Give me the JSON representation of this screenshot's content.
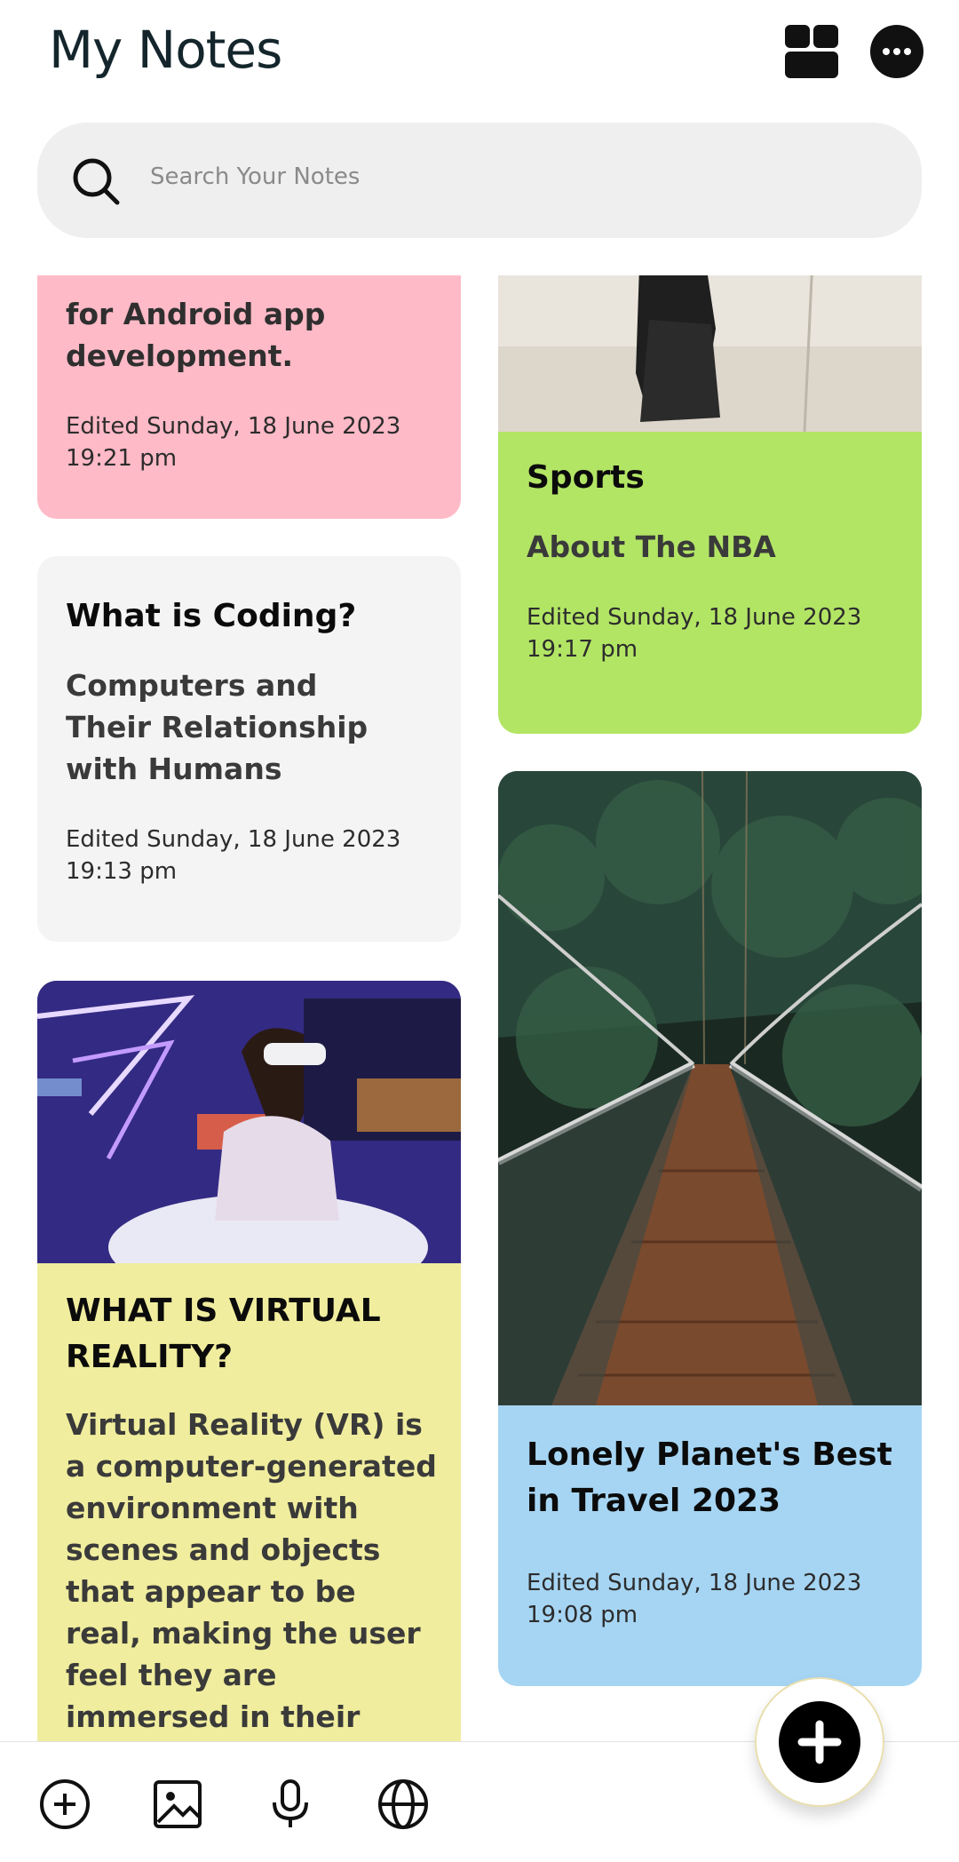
{
  "header": {
    "title": "My Notes",
    "grid_icon": "grid-view-icon",
    "more_icon": "more-horizontal-icon"
  },
  "search": {
    "placeholder": "Search Your Notes",
    "icon": "search-icon"
  },
  "notes": {
    "ide": {
      "body": "for Android app development.",
      "date": "Edited Sunday, 18 June 2023 19:21 pm",
      "color": "#ffbac7"
    },
    "sports": {
      "title": "Sports",
      "body": "About The NBA",
      "date": "Edited Sunday, 18 June 2023 19:17 pm",
      "color": "#b3e565"
    },
    "coding": {
      "title": "What is Coding?",
      "body": "Computers and Their Relationship with Humans",
      "date": "Edited Sunday, 18 June 2023 19:13 pm",
      "color": "#f4f4f4"
    },
    "vr": {
      "title": "WHAT IS VIRTUAL REALITY?",
      "body": "Virtual Reality (VR) is a computer-generated environment with scenes and objects that appear to be real, making the user feel they are immersed in their surroundings.",
      "color": "#f0ed9e"
    },
    "travel": {
      "title": "Lonely Planet's Best in Travel 2023",
      "date": "Edited Sunday, 18 June 2023 19:08 pm",
      "color": "#a6d5f3"
    }
  },
  "toolbar": {
    "icons": [
      "add-circle-icon",
      "image-icon",
      "microphone-icon",
      "globe-icon"
    ]
  },
  "fab": {
    "icon": "plus-icon"
  }
}
